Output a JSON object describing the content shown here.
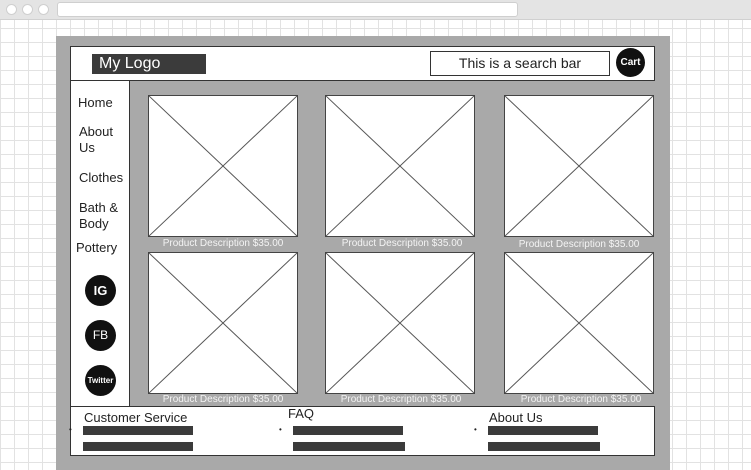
{
  "header": {
    "logo_text": "My Logo",
    "search_placeholder": "This is a search bar",
    "cart_label": "Cart"
  },
  "sidebar": {
    "items": [
      {
        "label": "Home"
      },
      {
        "label": "About Us"
      },
      {
        "label": "Clothes"
      },
      {
        "label": "Bath & Body"
      },
      {
        "label": "Pottery"
      }
    ],
    "social": [
      {
        "label": "IG"
      },
      {
        "label": "FB"
      },
      {
        "label": "Twitter"
      }
    ]
  },
  "products": [
    {
      "description": "Product Description $35.00"
    },
    {
      "description": "Product Description $35.00"
    },
    {
      "description": "Product Description $35.00"
    },
    {
      "description": "Product Description $35.00"
    },
    {
      "description": "Product Description $35.00"
    },
    {
      "description": "Product Description $35.00"
    }
  ],
  "footer": {
    "columns": [
      {
        "heading": "Customer Service"
      },
      {
        "heading": "FAQ"
      },
      {
        "heading": "About Us"
      }
    ]
  }
}
